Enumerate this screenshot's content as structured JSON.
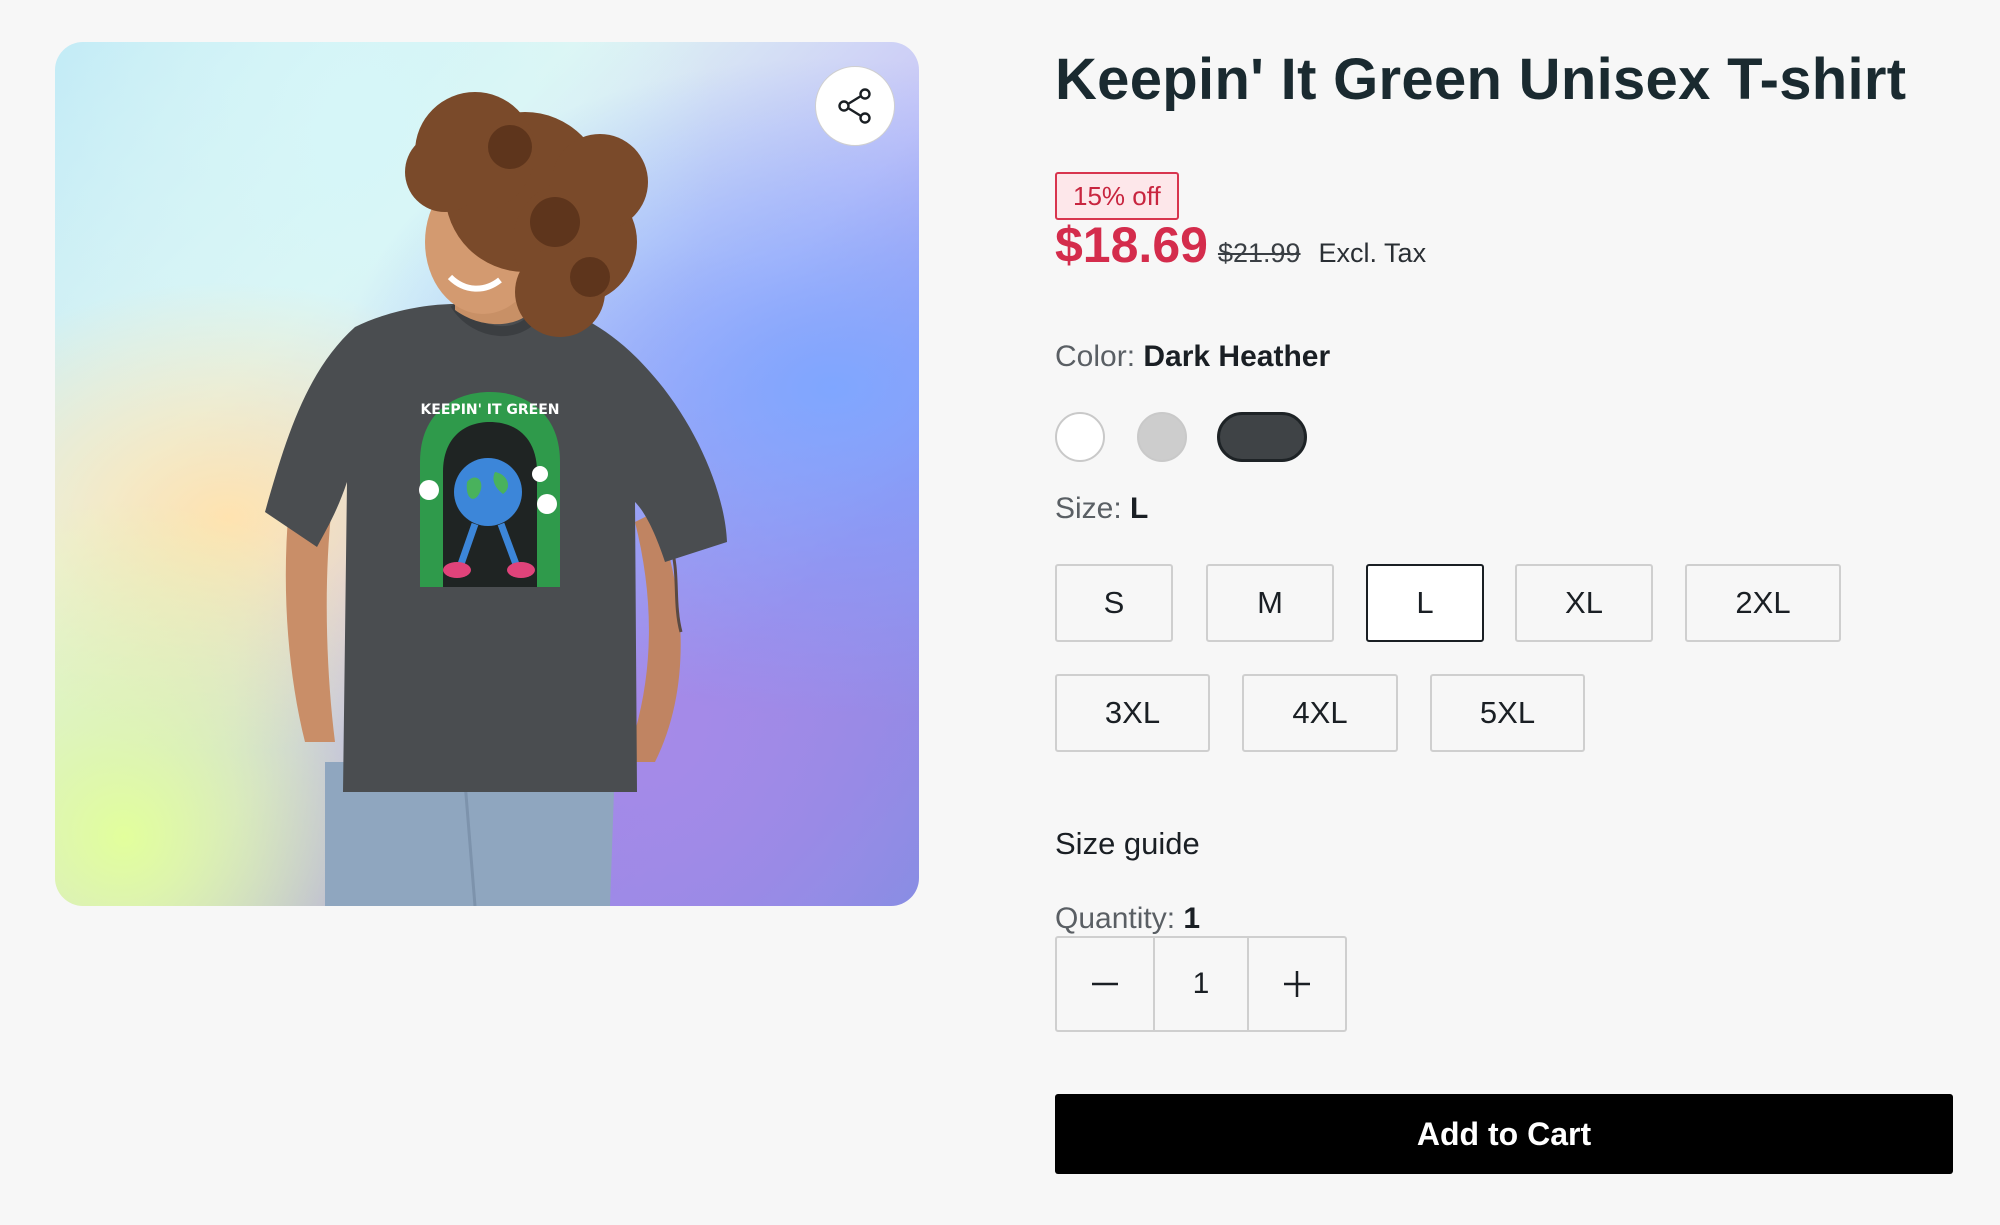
{
  "product": {
    "title": "Keepin' It Green Unisex T-shirt",
    "discount_badge": "15% off",
    "price": "$18.69",
    "original_price": "$21.99",
    "tax_note": "Excl. Tax"
  },
  "media": {
    "image_alt": "Woman wearing dark heather t-shirt",
    "print_text": "KEEPIN' IT GREEN",
    "share_icon": "share-icon"
  },
  "color": {
    "label": "Color:",
    "selected": "Dark Heather",
    "options": [
      {
        "name": "White",
        "hex": "#ffffff"
      },
      {
        "name": "Light Gray",
        "hex": "#cdcdcd"
      },
      {
        "name": "Dark Heather",
        "hex": "#3f4346"
      }
    ]
  },
  "size": {
    "label": "Size:",
    "selected": "L",
    "options": [
      "S",
      "M",
      "L",
      "XL",
      "2XL",
      "3XL",
      "4XL",
      "5XL"
    ]
  },
  "size_guide": "Size guide",
  "quantity": {
    "label": "Quantity:",
    "value": "1",
    "display": "1",
    "minus_icon": "minus-icon",
    "plus_icon": "plus-icon"
  },
  "add_to_cart": "Add to Cart",
  "colors": {
    "price_red": "#d42c4c",
    "badge_bg": "#fde7ea",
    "button_black": "#000000"
  }
}
